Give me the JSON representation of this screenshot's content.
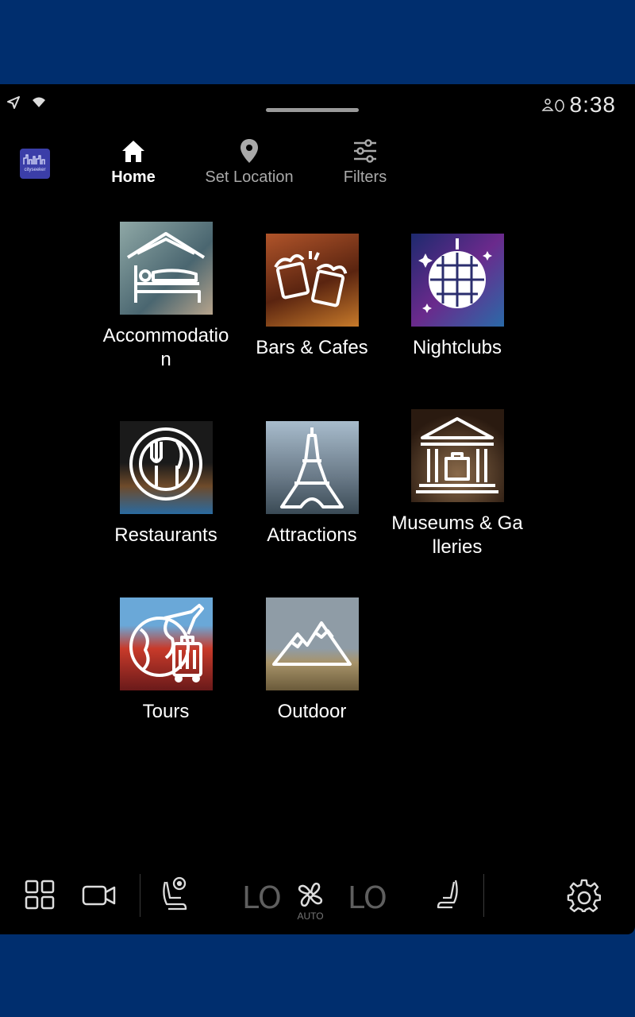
{
  "status": {
    "clock": "8:38"
  },
  "app": {
    "logo_text": "cityseeker"
  },
  "nav": [
    {
      "label": "Home",
      "icon": "home-icon",
      "active": true
    },
    {
      "label": "Set Location",
      "icon": "location-pin-icon",
      "active": false
    },
    {
      "label": "Filters",
      "icon": "sliders-icon",
      "active": false
    }
  ],
  "categories": [
    {
      "label": "Accommodation",
      "icon": "bed-icon",
      "color": "#6d8a8f"
    },
    {
      "label": "Bars & Cafes",
      "icon": "beer-mugs-icon",
      "color": "#7a3a1c"
    },
    {
      "label": "Nightclubs",
      "icon": "disco-ball-icon",
      "color": "#2b2e6e"
    },
    {
      "label": "Restaurants",
      "icon": "plate-cutlery-icon",
      "color": "#4a3a2a"
    },
    {
      "label": "Attractions",
      "icon": "eiffel-tower-icon",
      "color": "#5c6f82"
    },
    {
      "label": "Museums & Galleries",
      "icon": "museum-icon",
      "color": "#4a3a2c"
    },
    {
      "label": "Tours",
      "icon": "globe-luggage-icon",
      "color": "#8a2a2a"
    },
    {
      "label": "Outdoor",
      "icon": "mountains-icon",
      "color": "#6f6a55"
    }
  ],
  "climate": {
    "left_temp": "LO",
    "right_temp": "LO",
    "fan_mode": "AUTO"
  },
  "colors": {
    "frame": "#002e6e",
    "screen": "#000000",
    "inactive": "#a9a9a9"
  }
}
